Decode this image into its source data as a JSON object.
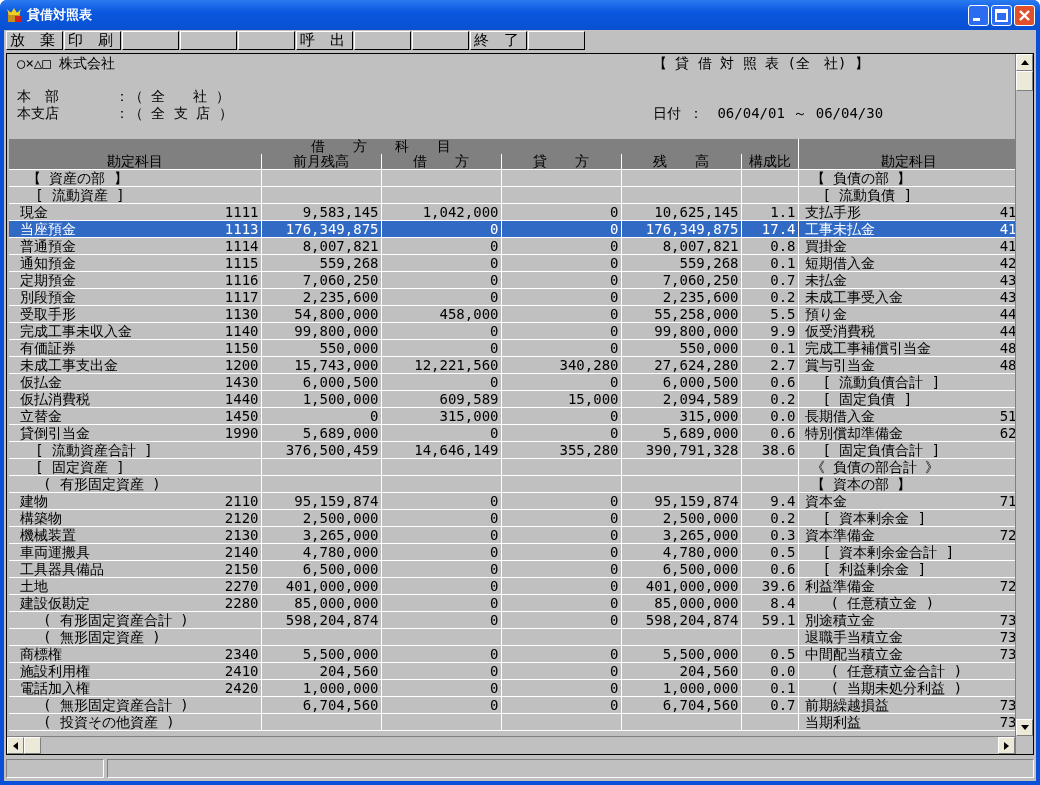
{
  "window": {
    "title": "貸借対照表"
  },
  "toolbar": [
    {
      "kind": "labeled",
      "label": "放　棄"
    },
    {
      "kind": "labeled",
      "label": "印　刷"
    },
    {
      "kind": "blank"
    },
    {
      "kind": "blank"
    },
    {
      "kind": "blank"
    },
    {
      "kind": "labeled",
      "label": "呼　出"
    },
    {
      "kind": "blank"
    },
    {
      "kind": "blank"
    },
    {
      "kind": "labeled",
      "label": "終　了"
    },
    {
      "kind": "blank"
    }
  ],
  "report": {
    "company": "○×△□ 株式会社",
    "title": "【 貸 借 対 照 表 (全　社) 】",
    "filters": [
      {
        "label": "本　部",
        "value": "：（ 全　　社 ）"
      },
      {
        "label": "本支店",
        "value": "：（ 全 支 店 ）"
      }
    ],
    "date_label": "日付 ：",
    "date_range": "06/04/01 ～ 06/04/30"
  },
  "table": {
    "group_header": "借　　方　　科　　目",
    "columns": [
      "勘定科目",
      "前月残高",
      "借　　方",
      "貸　　方",
      "残　　高",
      "構成比",
      "勘定科目"
    ],
    "rows": [
      {
        "selected": false,
        "left": {
          "kind": "section",
          "account": "【 資産の部 】"
        },
        "right": {
          "kind": "section",
          "account": "【 負債の部 】"
        }
      },
      {
        "selected": false,
        "left": {
          "kind": "group",
          "account": "[ 流動資産 ]"
        },
        "right": {
          "kind": "group",
          "account": "[ 流動負債 ]"
        }
      },
      {
        "selected": false,
        "left": {
          "kind": "account",
          "account": "現金",
          "code": "1111",
          "prev": "9,583,145",
          "debit": "1,042,000",
          "credit": "0",
          "balance": "10,625,145",
          "ratio": "1.1"
        },
        "right": {
          "kind": "account",
          "account": "支払手形",
          "code": "41"
        }
      },
      {
        "selected": true,
        "left": {
          "kind": "account",
          "account": "当座預金",
          "code": "1113",
          "prev": "176,349,875",
          "debit": "0",
          "credit": "0",
          "balance": "176,349,875",
          "ratio": "17.4"
        },
        "right": {
          "kind": "account",
          "account": "工事未払金",
          "code": "41"
        }
      },
      {
        "selected": false,
        "left": {
          "kind": "account",
          "account": "普通預金",
          "code": "1114",
          "prev": "8,007,821",
          "debit": "0",
          "credit": "0",
          "balance": "8,007,821",
          "ratio": "0.8"
        },
        "right": {
          "kind": "account",
          "account": "買掛金",
          "code": "41"
        }
      },
      {
        "selected": false,
        "left": {
          "kind": "account",
          "account": "通知預金",
          "code": "1115",
          "prev": "559,268",
          "debit": "0",
          "credit": "0",
          "balance": "559,268",
          "ratio": "0.1"
        },
        "right": {
          "kind": "account",
          "account": "短期借入金",
          "code": "42"
        }
      },
      {
        "selected": false,
        "left": {
          "kind": "account",
          "account": "定期預金",
          "code": "1116",
          "prev": "7,060,250",
          "debit": "0",
          "credit": "0",
          "balance": "7,060,250",
          "ratio": "0.7"
        },
        "right": {
          "kind": "account",
          "account": "未払金",
          "code": "43"
        }
      },
      {
        "selected": false,
        "left": {
          "kind": "account",
          "account": "別段預金",
          "code": "1117",
          "prev": "2,235,600",
          "debit": "0",
          "credit": "0",
          "balance": "2,235,600",
          "ratio": "0.2"
        },
        "right": {
          "kind": "account",
          "account": "未成工事受入金",
          "code": "43"
        }
      },
      {
        "selected": false,
        "left": {
          "kind": "account",
          "account": "受取手形",
          "code": "1130",
          "prev": "54,800,000",
          "debit": "458,000",
          "credit": "0",
          "balance": "55,258,000",
          "ratio": "5.5"
        },
        "right": {
          "kind": "account",
          "account": "預り金",
          "code": "44"
        }
      },
      {
        "selected": false,
        "left": {
          "kind": "account",
          "account": "完成工事未収入金",
          "code": "1140",
          "prev": "99,800,000",
          "debit": "0",
          "credit": "0",
          "balance": "99,800,000",
          "ratio": "9.9"
        },
        "right": {
          "kind": "account",
          "account": "仮受消費税",
          "code": "44"
        }
      },
      {
        "selected": false,
        "left": {
          "kind": "account",
          "account": "有価証券",
          "code": "1150",
          "prev": "550,000",
          "debit": "0",
          "credit": "0",
          "balance": "550,000",
          "ratio": "0.1"
        },
        "right": {
          "kind": "account",
          "account": "完成工事補償引当金",
          "code": "48"
        }
      },
      {
        "selected": false,
        "left": {
          "kind": "account",
          "account": "未成工事支出金",
          "code": "1200",
          "prev": "15,743,000",
          "debit": "12,221,560",
          "credit": "340,280",
          "balance": "27,624,280",
          "ratio": "2.7"
        },
        "right": {
          "kind": "account",
          "account": "賞与引当金",
          "code": "48"
        }
      },
      {
        "selected": false,
        "left": {
          "kind": "account",
          "account": "仮払金",
          "code": "1430",
          "prev": "6,000,500",
          "debit": "0",
          "credit": "0",
          "balance": "6,000,500",
          "ratio": "0.6"
        },
        "right": {
          "kind": "group",
          "account": "[ 流動負債合計 ]"
        }
      },
      {
        "selected": false,
        "left": {
          "kind": "account",
          "account": "仮払消費税",
          "code": "1440",
          "prev": "1,500,000",
          "debit": "609,589",
          "credit": "15,000",
          "balance": "2,094,589",
          "ratio": "0.2"
        },
        "right": {
          "kind": "group",
          "account": "[ 固定負債 ]"
        }
      },
      {
        "selected": false,
        "left": {
          "kind": "account",
          "account": "立替金",
          "code": "1450",
          "prev": "0",
          "debit": "315,000",
          "credit": "0",
          "balance": "315,000",
          "ratio": "0.0"
        },
        "right": {
          "kind": "account",
          "account": "長期借入金",
          "code": "51"
        }
      },
      {
        "selected": false,
        "left": {
          "kind": "account",
          "account": "貸倒引当金",
          "code": "1990",
          "prev": "5,689,000",
          "debit": "0",
          "credit": "0",
          "balance": "5,689,000",
          "ratio": "0.6"
        },
        "right": {
          "kind": "account",
          "account": "特別償却準備金",
          "code": "62"
        }
      },
      {
        "selected": false,
        "left": {
          "kind": "group",
          "account": "[ 流動資産合計 ]",
          "prev": "376,500,459",
          "debit": "14,646,149",
          "credit": "355,280",
          "balance": "390,791,328",
          "ratio": "38.6"
        },
        "right": {
          "kind": "group",
          "account": "[ 固定負債合計 ]"
        }
      },
      {
        "selected": false,
        "left": {
          "kind": "group",
          "account": "[ 固定資産 ]"
        },
        "right": {
          "kind": "section",
          "account": "《 負債の部合計 》"
        }
      },
      {
        "selected": false,
        "left": {
          "kind": "subgroup",
          "account": "( 有形固定資産 )"
        },
        "right": {
          "kind": "section",
          "account": "【 資本の部 】"
        }
      },
      {
        "selected": false,
        "left": {
          "kind": "account",
          "account": "建物",
          "code": "2110",
          "prev": "95,159,874",
          "debit": "0",
          "credit": "0",
          "balance": "95,159,874",
          "ratio": "9.4"
        },
        "right": {
          "kind": "account",
          "account": "資本金",
          "code": "71"
        }
      },
      {
        "selected": false,
        "left": {
          "kind": "account",
          "account": "構築物",
          "code": "2120",
          "prev": "2,500,000",
          "debit": "0",
          "credit": "0",
          "balance": "2,500,000",
          "ratio": "0.2"
        },
        "right": {
          "kind": "group",
          "account": "[ 資本剰余金 ]"
        }
      },
      {
        "selected": false,
        "left": {
          "kind": "account",
          "account": "機械装置",
          "code": "2130",
          "prev": "3,265,000",
          "debit": "0",
          "credit": "0",
          "balance": "3,265,000",
          "ratio": "0.3"
        },
        "right": {
          "kind": "account",
          "account": "資本準備金",
          "code": "72"
        }
      },
      {
        "selected": false,
        "left": {
          "kind": "account",
          "account": "車両運搬具",
          "code": "2140",
          "prev": "4,780,000",
          "debit": "0",
          "credit": "0",
          "balance": "4,780,000",
          "ratio": "0.5"
        },
        "right": {
          "kind": "group",
          "account": "[ 資本剰余金合計 ]"
        }
      },
      {
        "selected": false,
        "left": {
          "kind": "account",
          "account": "工具器具備品",
          "code": "2150",
          "prev": "6,500,000",
          "debit": "0",
          "credit": "0",
          "balance": "6,500,000",
          "ratio": "0.6"
        },
        "right": {
          "kind": "group",
          "account": "[ 利益剰余金 ]"
        }
      },
      {
        "selected": false,
        "left": {
          "kind": "account",
          "account": "土地",
          "code": "2270",
          "prev": "401,000,000",
          "debit": "0",
          "credit": "0",
          "balance": "401,000,000",
          "ratio": "39.6"
        },
        "right": {
          "kind": "account",
          "account": "利益準備金",
          "code": "72"
        }
      },
      {
        "selected": false,
        "left": {
          "kind": "account",
          "account": "建設仮勘定",
          "code": "2280",
          "prev": "85,000,000",
          "debit": "0",
          "credit": "0",
          "balance": "85,000,000",
          "ratio": "8.4"
        },
        "right": {
          "kind": "subgroup",
          "account": "( 任意積立金 )"
        }
      },
      {
        "selected": false,
        "left": {
          "kind": "subgroup",
          "account": "( 有形固定資産合計 )",
          "prev": "598,204,874",
          "debit": "0",
          "credit": "0",
          "balance": "598,204,874",
          "ratio": "59.1"
        },
        "right": {
          "kind": "account",
          "account": "別途積立金",
          "code": "73"
        }
      },
      {
        "selected": false,
        "left": {
          "kind": "subgroup",
          "account": "( 無形固定資産 )"
        },
        "right": {
          "kind": "account",
          "account": "退職手当積立金",
          "code": "73"
        }
      },
      {
        "selected": false,
        "left": {
          "kind": "account",
          "account": "商標権",
          "code": "2340",
          "prev": "5,500,000",
          "debit": "0",
          "credit": "0",
          "balance": "5,500,000",
          "ratio": "0.5"
        },
        "right": {
          "kind": "account",
          "account": "中間配当積立金",
          "code": "73"
        }
      },
      {
        "selected": false,
        "left": {
          "kind": "account",
          "account": "施設利用権",
          "code": "2410",
          "prev": "204,560",
          "debit": "0",
          "credit": "0",
          "balance": "204,560",
          "ratio": "0.0"
        },
        "right": {
          "kind": "subgroup",
          "account": "( 任意積立金合計 )"
        }
      },
      {
        "selected": false,
        "left": {
          "kind": "account",
          "account": "電話加入権",
          "code": "2420",
          "prev": "1,000,000",
          "debit": "0",
          "credit": "0",
          "balance": "1,000,000",
          "ratio": "0.1"
        },
        "right": {
          "kind": "subgroup",
          "account": "( 当期未処分利益 )"
        }
      },
      {
        "selected": false,
        "left": {
          "kind": "subgroup",
          "account": "( 無形固定資産合計 )",
          "prev": "6,704,560",
          "debit": "0",
          "credit": "0",
          "balance": "6,704,560",
          "ratio": "0.7"
        },
        "right": {
          "kind": "account",
          "account": "前期繰越損益",
          "code": "73"
        }
      },
      {
        "selected": false,
        "left": {
          "kind": "subgroup",
          "account": "( 投資その他資産 )"
        },
        "right": {
          "kind": "account",
          "account": "当期利益",
          "code": "73"
        }
      }
    ]
  }
}
